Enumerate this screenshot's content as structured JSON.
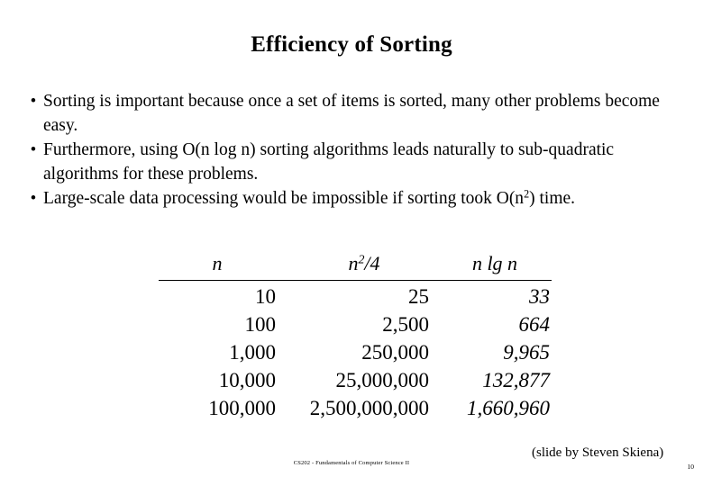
{
  "slide": {
    "title": "Efficiency of Sorting",
    "bullet_marker": "•",
    "bullets": [
      {
        "id": "bullet-sorting-important",
        "segments": [
          {
            "type": "text",
            "value": "Sorting is important because once a set of items is sorted, many other problems become easy."
          }
        ]
      },
      {
        "id": "bullet-nlogn-subquadratic",
        "segments": [
          {
            "type": "text",
            "value": "Furthermore, using O(n log n) sorting algorithms leads naturally to sub-quadratic algorithms for these problems."
          }
        ]
      },
      {
        "id": "bullet-large-scale",
        "segments": [
          {
            "type": "text",
            "value": "Large-scale data processing would be impossible if sorting took O(n"
          },
          {
            "type": "sup",
            "value": "2"
          },
          {
            "type": "text",
            "value": ") time."
          }
        ]
      }
    ],
    "table": {
      "headers": {
        "n": "n",
        "n_squared_over_4_base": "n",
        "n_squared_over_4_sup": "2",
        "n_squared_over_4_tail": "/4",
        "n_lg_n": "n lg n"
      },
      "rows": [
        {
          "n": "10",
          "n2_over_4": "25",
          "n_lg_n": "33"
        },
        {
          "n": "100",
          "n2_over_4": "2,500",
          "n_lg_n": "664"
        },
        {
          "n": "1,000",
          "n2_over_4": "250,000",
          "n_lg_n": "9,965"
        },
        {
          "n": "10,000",
          "n2_over_4": "25,000,000",
          "n_lg_n": "132,877"
        },
        {
          "n": "100,000",
          "n2_over_4": "2,500,000,000",
          "n_lg_n": "1,660,960"
        }
      ]
    },
    "attribution": "(slide by Steven Skiena)",
    "course_footer": "CS202 - Fundamentals of Computer Science II",
    "page_number": "10"
  },
  "chart_data": {
    "type": "table",
    "title": "Efficiency of Sorting",
    "columns": [
      "n",
      "n^2/4",
      "n lg n"
    ],
    "rows": [
      {
        "n": 10,
        "n2_over_4": 25,
        "n_lg_n": 33
      },
      {
        "n": 100,
        "n2_over_4": 2500,
        "n_lg_n": 664
      },
      {
        "n": 1000,
        "n2_over_4": 250000,
        "n_lg_n": 9965
      },
      {
        "n": 10000,
        "n2_over_4": 25000000,
        "n_lg_n": 132877
      },
      {
        "n": 100000,
        "n2_over_4": 2500000000,
        "n_lg_n": 1660960
      }
    ]
  }
}
